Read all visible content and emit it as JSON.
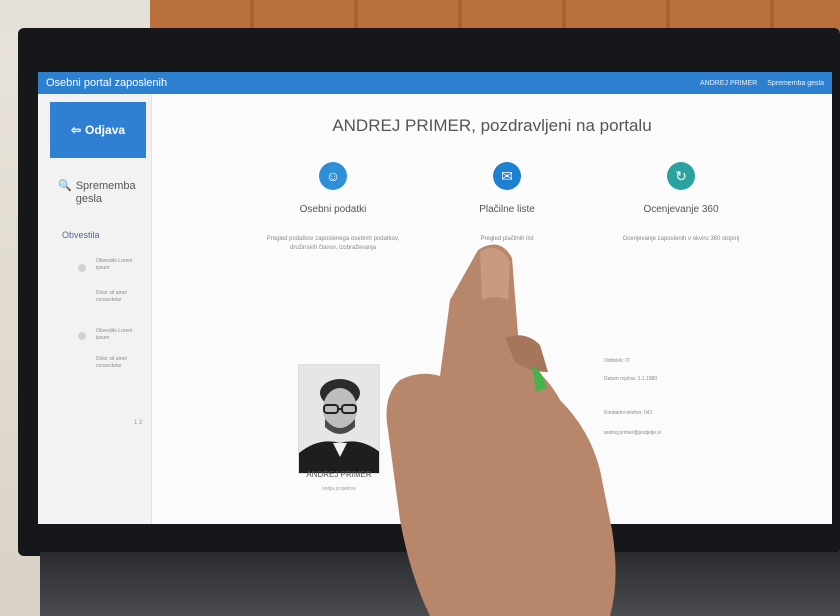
{
  "app": {
    "title": "Osebni portal zaposlenih",
    "user_link": "ANDREJ PRIMER",
    "logout_link": "Sprememba gesla"
  },
  "sidebar": {
    "logout_label": "Odjava",
    "change_password_label": "Sprememba gesla",
    "notifications_title": "Obvestila",
    "notifications": [
      {
        "text": "Obvestilo Lorem ipsum"
      },
      {
        "text": "Dolor sit amet consectetur"
      },
      {
        "text": "Obvestilo Lorem ipsum"
      },
      {
        "text": "Dolor sit amet consectetur"
      }
    ],
    "pager": "1 2"
  },
  "main": {
    "welcome": "ANDREJ PRIMER, pozdravljeni na portalu",
    "cards": [
      {
        "title": "Osebni podatki",
        "desc": "Pregled podatkov zaposlenega\nosebnih podatkov, družinskih\nčlanov, izobraževanja",
        "icon": "user-icon",
        "color": "#2f8fd6"
      },
      {
        "title": "Plačilne liste",
        "desc": "Pregled plačilnih list",
        "icon": "mail-icon",
        "color": "#1f7fd0"
      },
      {
        "title": "Ocenjevanje 360",
        "desc": "Ocenjevanje zaposlenih v okviru 360\nstopinj",
        "icon": "refresh-icon",
        "color": "#2aa3a0"
      }
    ],
    "profile": {
      "name": "ANDREJ PRIMER",
      "subtitle": "vodja projektov"
    },
    "info_lines": [
      "Oddelek: IT",
      "Datum rojstva: 1.1.1980",
      "Kontaktni telefon: 041",
      "andrej.primer@podjetje.si"
    ]
  }
}
